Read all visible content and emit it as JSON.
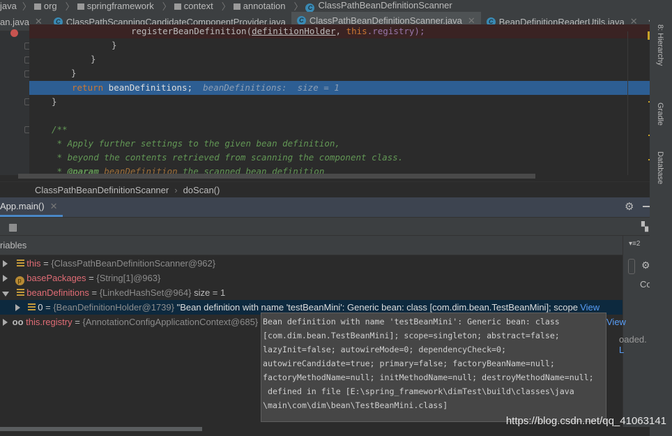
{
  "breadcrumb": [
    "java",
    "org",
    "springframework",
    "context",
    "annotation",
    "ClassPathBeanDefinitionScanner"
  ],
  "tabs": [
    {
      "label": "an.java",
      "active": false
    },
    {
      "label": "ClassPathScanningCandidateComponentProvider.java",
      "active": false
    },
    {
      "label": "ClassPathBeanDefinitionScanner.java",
      "active": true
    },
    {
      "label": "BeanDefinitionReaderUtils.java",
      "active": false
    }
  ],
  "tab_overflow": "7",
  "code": {
    "l1a": "registerBeanDefinition(",
    "l1b": "definitionHolder",
    "l1sep": ", ",
    "l1c": "this",
    "l1d": ".registry);",
    "brace1": "}",
    "brace2": "}",
    "brace3": "}",
    "ret_kw": "return",
    "ret_rest": " beanDefinitions;",
    "ret_hint": "beanDefinitions:  size = 1",
    "brace4": "}",
    "c1": "/**",
    "c2": " * Apply further settings to the given bean definition,",
    "c3": " * beyond the contents retrieved from scanning the component class.",
    "c4a": " * ",
    "c4b": "@param",
    "c4c": " beanDefinition",
    "c4d": " the scanned bean definition"
  },
  "editor_breadcrumb": [
    "ClassPathBeanDefinitionScanner",
    "doScan()"
  ],
  "debug": {
    "tab": "App.main()",
    "variables_label": "riables",
    "right_count": "2",
    "right_label": "Cou",
    "loaded": "oaded.",
    "loaded_link": "L"
  },
  "variables": [
    {
      "name": "this",
      "value": "{ClassPathBeanDefinitionScanner@962}",
      "icon": "field"
    },
    {
      "name": "basePackages",
      "value": "{String[1]@963}",
      "icon": "param"
    },
    {
      "name": "beanDefinitions",
      "value": "{LinkedHashSet@964}",
      "extra": "size = 1",
      "icon": "field",
      "expanded": true
    },
    {
      "name": "0",
      "value": "{BeanDefinitionHolder@1739}",
      "extra": "\"Bean definition with name 'testBeanMini': Generic bean: class [com.dim.bean.TestBeanMini]; scope=si...",
      "link": "View",
      "icon": "field",
      "selected": true
    },
    {
      "name": "this.registry",
      "value": "{AnnotationConfigApplicationContext@685}",
      "link": "View",
      "icon": "watch"
    }
  ],
  "tooltip": [
    "Bean definition with name 'testBeanMini': Generic bean: class",
    "[com.dim.bean.TestBeanMini]; scope=singleton; abstract=false;",
    "lazyInit=false; autowireMode=0; dependencyCheck=0;",
    "autowireCandidate=true; primary=false; factoryBeanName=null;",
    "factoryMethodName=null; initMethodName=null; destroyMethodName=null;",
    " defined in file [E:\\spring_framework\\dimTest\\build\\classes\\java",
    "\\main\\com\\dim\\bean\\TestBeanMini.class]"
  ],
  "side_tools": [
    "8: Hierarchy",
    "Gradle",
    "Database"
  ],
  "watermark": "https://blog.csdn.net/qq_41063141",
  "colors": {
    "accent": "#4a88c7",
    "selection": "#2d5e93",
    "keyword": "#cc7832",
    "comment": "#629755"
  }
}
